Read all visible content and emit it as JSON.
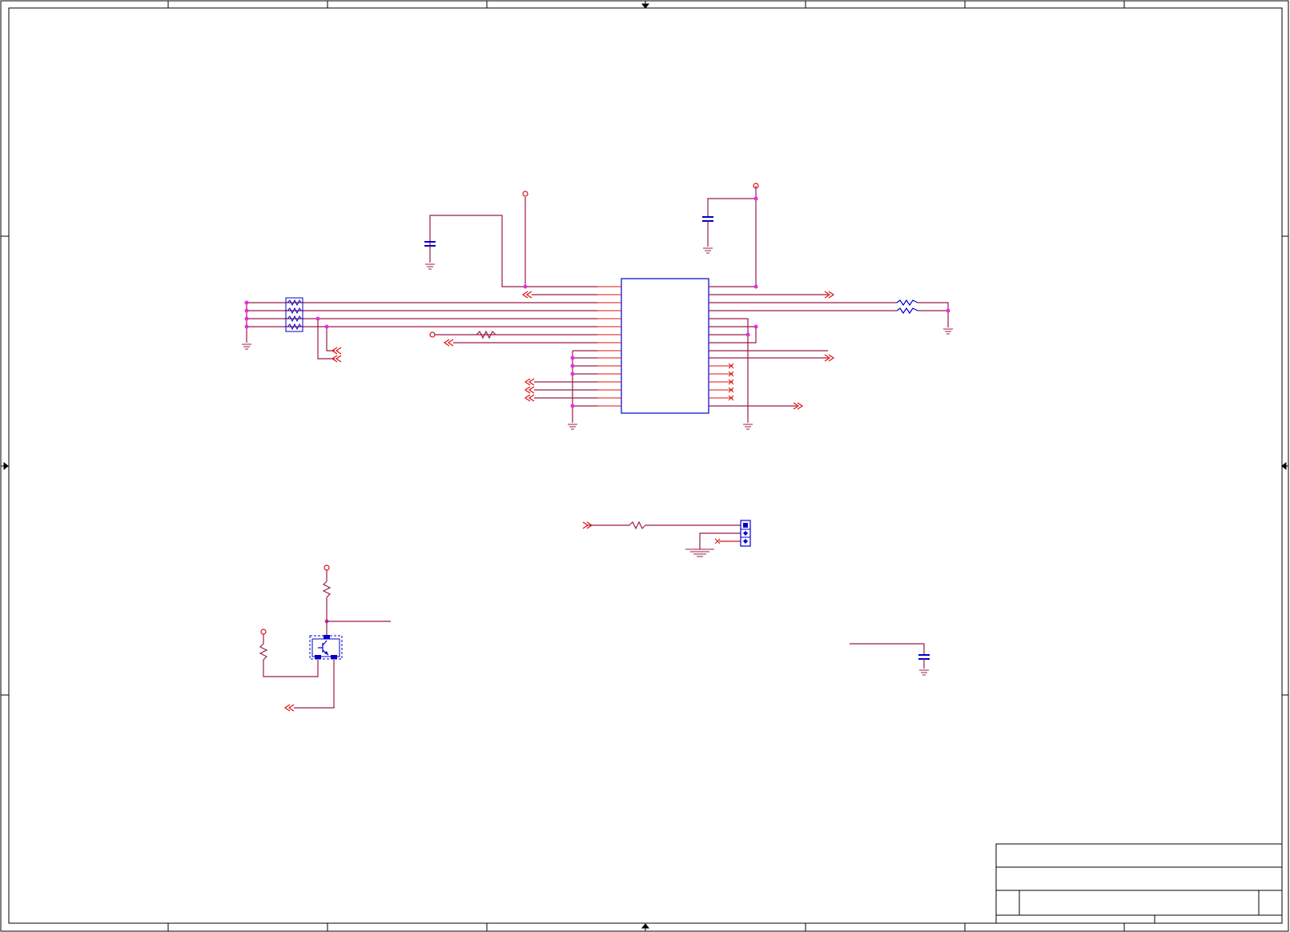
{
  "document": {
    "type": "schematic",
    "visible_text": "none"
  },
  "colors": {
    "background": "#ffffff",
    "border": "#000000",
    "wire": "#9b1b4a",
    "wire_red": "#e01010",
    "junction": "#e030e0",
    "component": "#0000cc",
    "power": "#d81010"
  },
  "title_block": {
    "title": "",
    "document_number": "",
    "revision": "",
    "sheet": ""
  }
}
